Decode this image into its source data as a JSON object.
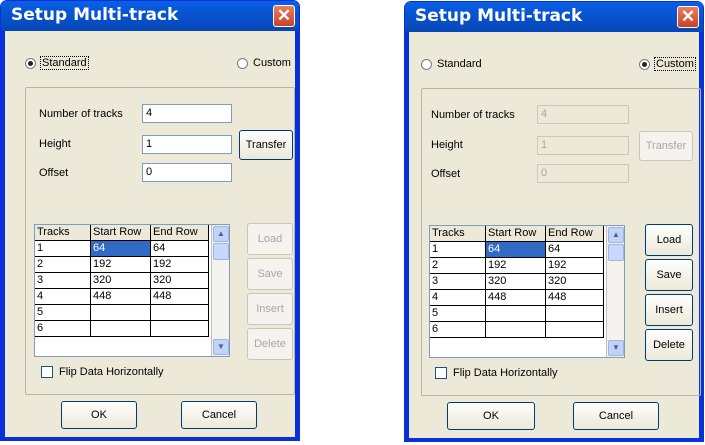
{
  "dialogs": [
    {
      "title": "Setup Multi-track",
      "close_glyph": "✕",
      "mode": "standard",
      "radio_standard": "Standard",
      "radio_custom": "Custom",
      "fields": {
        "tracks_label": "Number of tracks",
        "tracks_value": "4",
        "height_label": "Height",
        "height_value": "1",
        "offset_label": "Offset",
        "offset_value": "0"
      },
      "transfer_label": "Transfer",
      "table": {
        "columns": [
          "Tracks",
          "Start Row",
          "End Row"
        ],
        "rows": [
          [
            "1",
            "64",
            "64"
          ],
          [
            "2",
            "192",
            "192"
          ],
          [
            "3",
            "320",
            "320"
          ],
          [
            "4",
            "448",
            "448"
          ],
          [
            "5",
            "",
            ""
          ],
          [
            "6",
            "",
            ""
          ]
        ]
      },
      "side_buttons": [
        "Load",
        "Save",
        "Insert",
        "Delete"
      ],
      "flip_label": "Flip Data Horizontally",
      "ok_label": "OK",
      "cancel_label": "Cancel"
    },
    {
      "title": "Setup Multi-track",
      "close_glyph": "✕",
      "mode": "custom",
      "radio_standard": "Standard",
      "radio_custom": "Custom",
      "fields": {
        "tracks_label": "Number of tracks",
        "tracks_value": "4",
        "height_label": "Height",
        "height_value": "1",
        "offset_label": "Offset",
        "offset_value": "0"
      },
      "transfer_label": "Transfer",
      "table": {
        "columns": [
          "Tracks",
          "Start Row",
          "End Row"
        ],
        "rows": [
          [
            "1",
            "64",
            "64"
          ],
          [
            "2",
            "192",
            "192"
          ],
          [
            "3",
            "320",
            "320"
          ],
          [
            "4",
            "448",
            "448"
          ],
          [
            "5",
            "",
            ""
          ],
          [
            "6",
            "",
            ""
          ]
        ]
      },
      "side_buttons": [
        "Load",
        "Save",
        "Insert",
        "Delete"
      ],
      "flip_label": "Flip Data Horizontally",
      "ok_label": "OK",
      "cancel_label": "Cancel"
    }
  ],
  "colors": {
    "titlebar": "#0854d0",
    "dialog_bg": "#ece9d8",
    "close_button": "#d4563a",
    "selection": "#316ac5",
    "disabled_text": "#a7a6aa"
  }
}
